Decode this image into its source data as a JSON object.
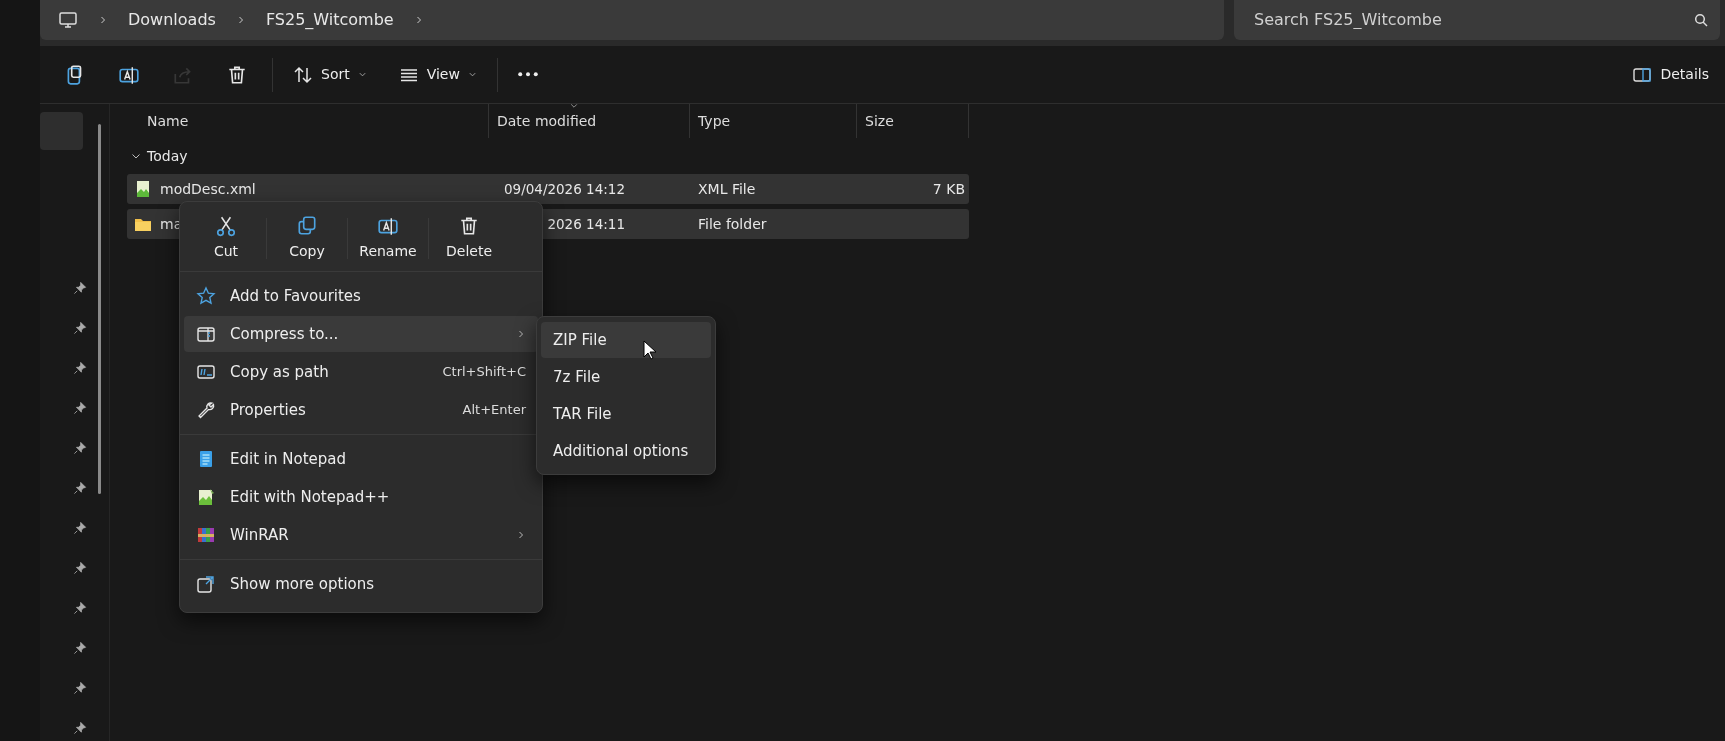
{
  "address_bar": {
    "breadcrumb": [
      {
        "label": "Downloads"
      },
      {
        "label": "FS25_Witcombe"
      }
    ]
  },
  "search": {
    "placeholder": "Search FS25_Witcombe"
  },
  "toolbar": {
    "icons": [
      {
        "kind": "paste",
        "disabled": false
      },
      {
        "kind": "rename",
        "disabled": false
      },
      {
        "kind": "share",
        "disabled": true
      },
      {
        "kind": "delete",
        "disabled": false
      }
    ],
    "sort": "Sort",
    "view": "View",
    "details": "Details"
  },
  "file_list": {
    "columns": [
      {
        "label": "Name",
        "sorted": false
      },
      {
        "label": "Date modified",
        "sorted": true
      },
      {
        "label": "Type",
        "sorted": false
      },
      {
        "label": "Size",
        "sorted": false
      }
    ],
    "group": {
      "label": "Today",
      "expanded": true
    },
    "rows": [
      {
        "kind": "xml",
        "name": "modDesc.xml",
        "date": "09/04/2026 14:12",
        "type": "XML File",
        "size": "7 KB",
        "selected": true
      },
      {
        "kind": "folder",
        "name": "ma",
        "date": "2026 14:11",
        "type": "File folder",
        "selected": true
      }
    ]
  },
  "context_menu": {
    "quick_actions": [
      {
        "kind": "cut",
        "label": "Cut"
      },
      {
        "kind": "copy",
        "label": "Copy"
      },
      {
        "kind": "rename",
        "label": "Rename"
      },
      {
        "kind": "delete",
        "label": "Delete"
      }
    ],
    "sections": [
      [
        {
          "kind": "star",
          "label": "Add to Favourites",
          "submenu": false,
          "selected": false
        },
        {
          "kind": "compress",
          "label": "Compress to...",
          "submenu": true,
          "selected": true
        },
        {
          "kind": "path",
          "label": "Copy as path",
          "shortcut": "Ctrl+Shift+C",
          "submenu": false,
          "selected": false
        },
        {
          "kind": "wrench",
          "label": "Properties",
          "shortcut": "Alt+Enter",
          "submenu": false,
          "selected": false
        }
      ],
      [
        {
          "kind": "notepad",
          "label": "Edit in Notepad",
          "submenu": false,
          "selected": false
        },
        {
          "kind": "notepadpp",
          "label": "Edit with Notepad++",
          "submenu": false,
          "selected": false
        },
        {
          "kind": "winrar",
          "label": "WinRAR",
          "submenu": true,
          "selected": false
        }
      ],
      [
        {
          "kind": "more",
          "label": "Show more options",
          "submenu": false,
          "selected": false
        }
      ]
    ],
    "submenu": [
      {
        "label": "ZIP File",
        "selected": true
      },
      {
        "label": "7z File",
        "selected": false
      },
      {
        "label": "TAR File",
        "selected": false
      },
      {
        "label": "Additional options",
        "selected": false
      }
    ]
  }
}
